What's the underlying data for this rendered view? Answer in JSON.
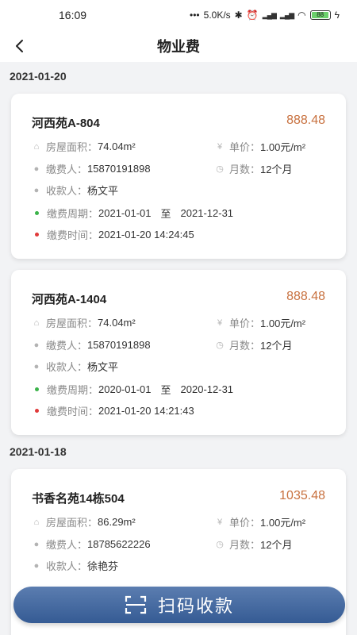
{
  "status_bar": {
    "time": "16:09",
    "network_speed": "5.0K/s",
    "battery_level": "88",
    "icons": [
      "bluetooth-icon",
      "alarm-icon",
      "signal-icon",
      "wifi-icon",
      "battery-icon",
      "charging-icon"
    ]
  },
  "header": {
    "back_icon": "back-arrow-icon",
    "title": "物业费"
  },
  "groups": [
    {
      "date": "2021-01-20",
      "records": [
        {
          "property": "河西苑A-804",
          "amount": "888.48",
          "area_label": "房屋面积：",
          "area_value": "74.04m²",
          "unit_price_label": "单价：",
          "unit_price_value": "1.00元/m²",
          "payer_label": "缴费人：",
          "payer_value": "15870191898",
          "months_label": "月数：",
          "months_value": "12个月",
          "collector_label": "收款人：",
          "collector_value": "杨文平",
          "period_label": "缴费周期：",
          "period_start": "2021-01-01",
          "period_to": "至",
          "period_end": "2021-12-31",
          "paid_time_label": "缴费时间：",
          "paid_time_value": "2021-01-20 14:24:45"
        },
        {
          "property": "河西苑A-1404",
          "amount": "888.48",
          "area_label": "房屋面积：",
          "area_value": "74.04m²",
          "unit_price_label": "单价：",
          "unit_price_value": "1.00元/m²",
          "payer_label": "缴费人：",
          "payer_value": "15870191898",
          "months_label": "月数：",
          "months_value": "12个月",
          "collector_label": "收款人：",
          "collector_value": "杨文平",
          "period_label": "缴费周期：",
          "period_start": "2020-01-01",
          "period_to": "至",
          "period_end": "2020-12-31",
          "paid_time_label": "缴费时间：",
          "paid_time_value": "2021-01-20 14:21:43"
        }
      ]
    },
    {
      "date": "2021-01-18",
      "records": [
        {
          "property": "书香名苑14栋504",
          "amount": "1035.48",
          "area_label": "房屋面积：",
          "area_value": "86.29m²",
          "unit_price_label": "单价：",
          "unit_price_value": "1.00元/m²",
          "payer_label": "缴费人：",
          "payer_value": "18785622226",
          "months_label": "月数：",
          "months_value": "12个月",
          "collector_label": "收款人：",
          "collector_value": "徐艳芬"
        }
      ]
    }
  ],
  "scan_button": {
    "icon": "scan-icon",
    "label": "扫码收款"
  },
  "colors": {
    "amount": "#c8713f",
    "button_gradient_top": "#5b7db0",
    "button_gradient_bottom": "#355b94",
    "period_dot": "#3bb34a",
    "time_dot": "#e03a3a"
  }
}
